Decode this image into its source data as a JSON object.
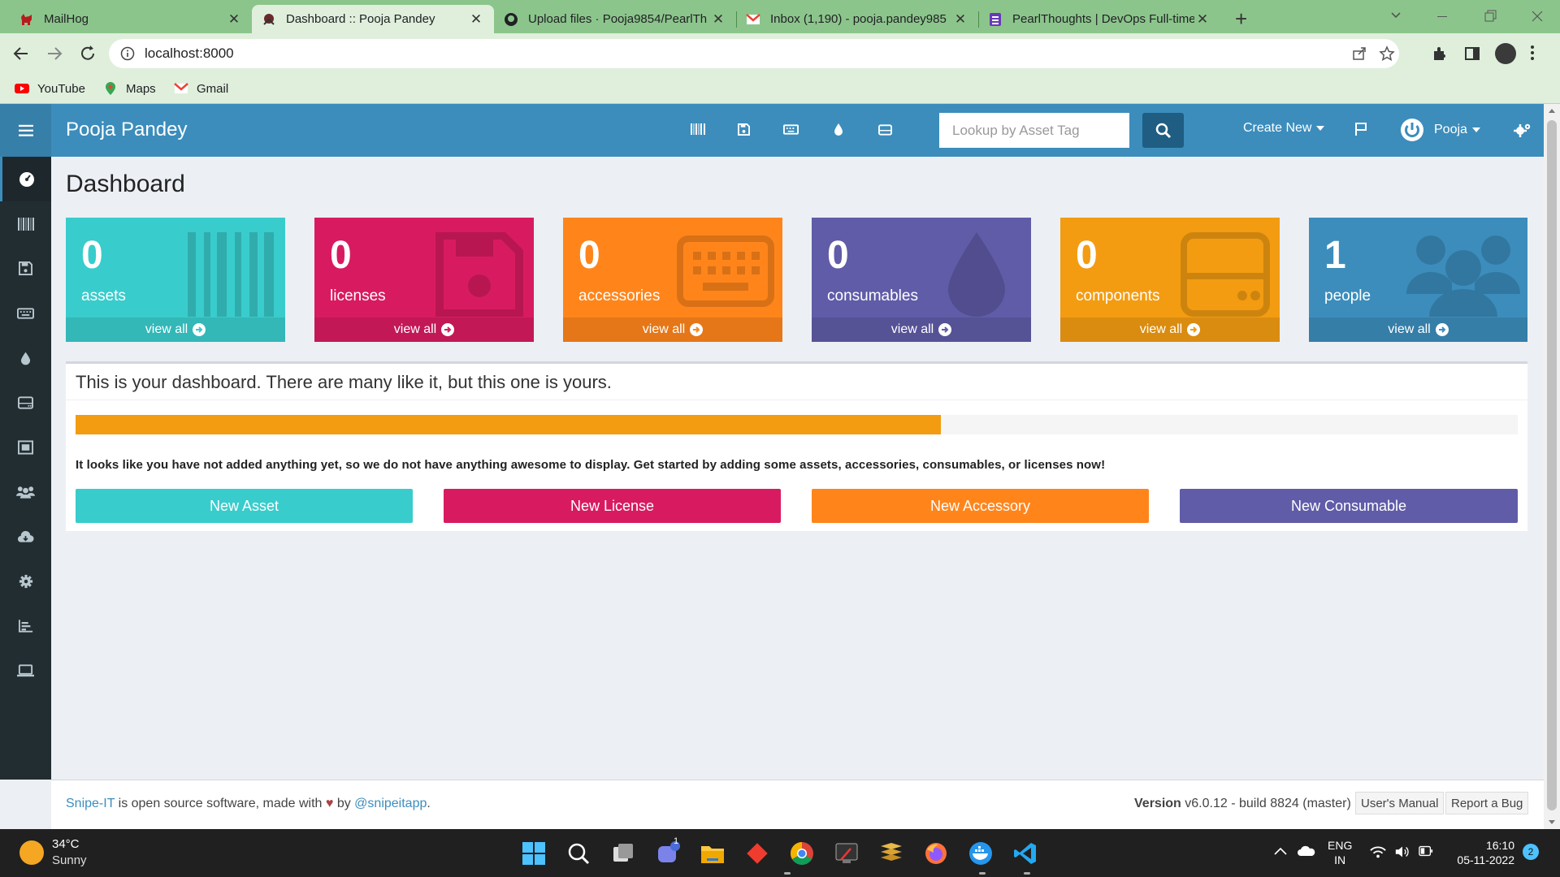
{
  "browser": {
    "tabs": [
      {
        "title": "MailHog",
        "favicon": "mailhog-pig-icon",
        "active": false
      },
      {
        "title": "Dashboard :: Pooja Pandey",
        "favicon": "snipeit-icon",
        "active": true
      },
      {
        "title": "Upload files · Pooja9854/PearlTh",
        "favicon": "github-icon",
        "active": false
      },
      {
        "title": "Inbox (1,190) - pooja.pandey985",
        "favicon": "gmail-icon",
        "active": false
      },
      {
        "title": "PearlThoughts | DevOps Full-time",
        "favicon": "forms-icon",
        "active": false
      }
    ],
    "new_tab_label": "+",
    "url": "localhost:8000",
    "bookmarks": [
      {
        "label": "YouTube",
        "icon": "youtube-icon"
      },
      {
        "label": "Maps",
        "icon": "maps-icon"
      },
      {
        "label": "Gmail",
        "icon": "gmail-icon"
      }
    ]
  },
  "app": {
    "site_name": "Pooja Pandey",
    "search_placeholder": "Lookup by Asset Tag",
    "create_new_label": "Create New",
    "user_name": "Pooja",
    "page_title": "Dashboard",
    "colors": {
      "navbar": "#3c8dbc",
      "sidebar": "#222d32",
      "assets": "#39cccc",
      "licenses": "#d81b60",
      "accessories": "#ff851b",
      "consumables": "#605ca8",
      "components": "#f39c12",
      "people": "#3c8dbc"
    },
    "tiles": [
      {
        "count": "0",
        "label": "assets",
        "link": "view all"
      },
      {
        "count": "0",
        "label": "licenses",
        "link": "view all"
      },
      {
        "count": "0",
        "label": "accessories",
        "link": "view all"
      },
      {
        "count": "0",
        "label": "consumables",
        "link": "view all"
      },
      {
        "count": "0",
        "label": "components",
        "link": "view all"
      },
      {
        "count": "1",
        "label": "people",
        "link": "view all"
      }
    ],
    "welcome_title": "This is your dashboard. There are many like it, but this one is yours.",
    "progress_fraction": 0.6,
    "empty_message": "It looks like you have not added anything yet, so we do not have anything awesome to display. Get started by adding some assets, accessories, consumables, or licenses now!",
    "buttons": [
      "New Asset",
      "New License",
      "New Accessory",
      "New Consumable"
    ],
    "footer": {
      "text_prefix": "Snipe-IT",
      "text_middle": " is open source software, made with ",
      "text_by": " by ",
      "handle": "@snipeitapp",
      "text_end": ".",
      "version_label": "Version",
      "version_value": " v6.0.12 - build 8824 (master)",
      "manual_label": "User's Manual",
      "bug_label": "Report a Bug"
    }
  },
  "taskbar": {
    "weather_temp": "34°C",
    "weather_desc": "Sunny",
    "teams_badge": "1",
    "lang_top": "ENG",
    "lang_bottom": "IN",
    "time": "16:10",
    "date": "05-11-2022",
    "notification_count": "2"
  }
}
